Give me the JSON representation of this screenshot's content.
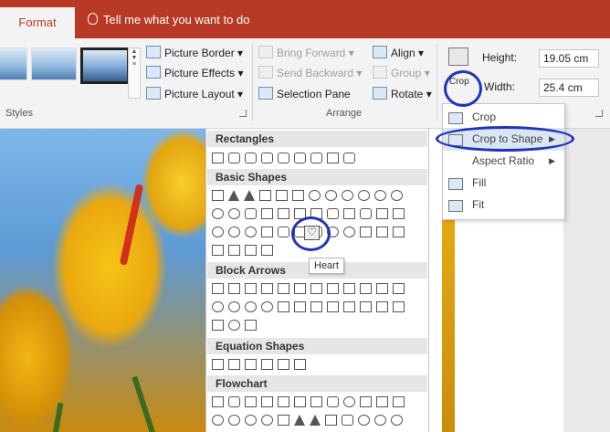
{
  "tabs": {
    "active": "Format",
    "tell_me": "Tell me what you want to do"
  },
  "ribbon": {
    "picture_border": "Picture Border",
    "picture_effects": "Picture Effects",
    "picture_layout": "Picture Layout",
    "bring_forward": "Bring Forward",
    "send_backward": "Send Backward",
    "selection_pane": "Selection Pane",
    "align": "Align",
    "group": "Group",
    "rotate": "Rotate",
    "styles_label": "Styles",
    "arrange_label": "Arrange",
    "crop_label": "Crop",
    "height_label": "Height:",
    "height_value": "19.05 cm",
    "width_label": "Width:",
    "width_value": "25.4 cm"
  },
  "shapes": {
    "rectangles": "Rectangles",
    "basic": "Basic Shapes",
    "block_arrows": "Block Arrows",
    "equation": "Equation Shapes",
    "flowchart": "Flowchart",
    "tooltip": "Heart"
  },
  "crop_menu": {
    "crop": "Crop",
    "crop_to_shape": "Crop to Shape",
    "aspect_ratio": "Aspect Ratio",
    "fill": "Fill",
    "fit": "Fit"
  },
  "colors": {
    "accent": "#b83a26",
    "annotation": "#2233bb"
  }
}
